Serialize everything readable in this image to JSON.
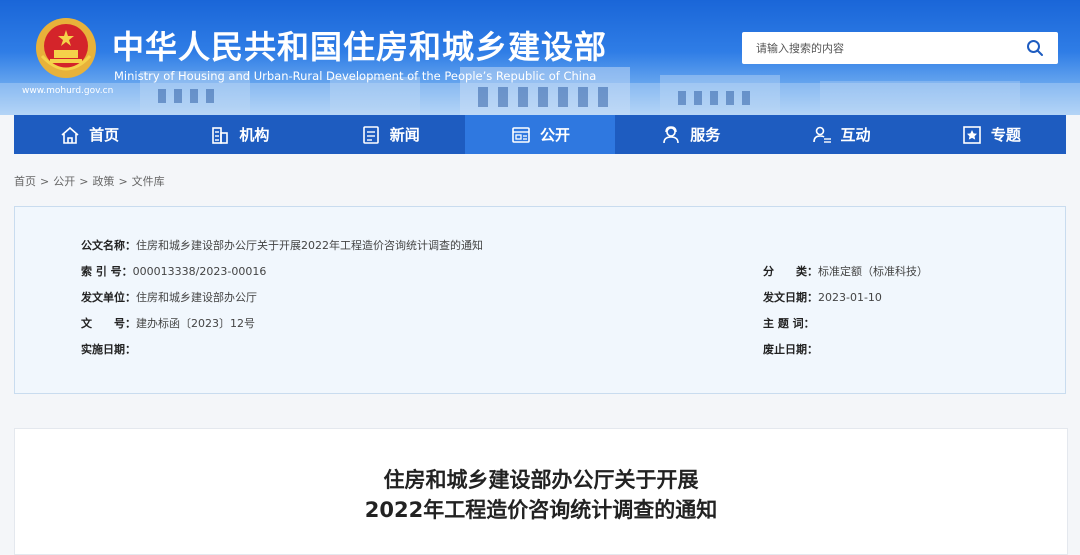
{
  "header": {
    "title": "中华人民共和国住房和城乡建设部",
    "subtitle": "Ministry of Housing and Urban-Rural Development of the People’s Republic of China",
    "url": "www.mohurd.gov.cn"
  },
  "search": {
    "placeholder": "请输入搜索的内容",
    "icon": "search-icon"
  },
  "nav": {
    "items": [
      {
        "label": "首页",
        "icon": "home-icon"
      },
      {
        "label": "机构",
        "icon": "building-icon"
      },
      {
        "label": "新闻",
        "icon": "news-icon"
      },
      {
        "label": "公开",
        "icon": "publicity-icon",
        "active": true
      },
      {
        "label": "服务",
        "icon": "service-icon"
      },
      {
        "label": "互动",
        "icon": "interaction-icon"
      },
      {
        "label": "专题",
        "icon": "topic-icon"
      }
    ]
  },
  "breadcrumb": [
    "首页",
    "公开",
    "政策",
    "文件库"
  ],
  "breadcrumb_sep": ">",
  "info": {
    "name_label": "公文名称：",
    "name_value": "住房和城乡建设部办公厅关于开展2022年工程造价咨询统计调查的通知",
    "index_label": "索 引 号：",
    "index_value": "000013338/2023-00016",
    "category_label": "分　　类：",
    "category_value": "标准定额（标准科技）",
    "issuer_label": "发文单位：",
    "issuer_value": "住房和城乡建设部办公厅",
    "date_label": "发文日期：",
    "date_value": "2023-01-10",
    "docno_label": "文　　号：",
    "docno_value": "建办标函〔2023〕12号",
    "keywords_label": "主 题 词：",
    "keywords_value": "",
    "effective_label": "实施日期：",
    "effective_value": "",
    "expire_label": "废止日期：",
    "expire_value": ""
  },
  "article": {
    "title_line1": "住房和城乡建设部办公厅关于开展",
    "title_line2": "2022年工程造价咨询统计调查的通知"
  },
  "colors": {
    "nav": "#1e5cc0",
    "nav_active": "#2f78e0",
    "header_top": "#1a66d8",
    "info_bg": "#f1f7fd"
  }
}
